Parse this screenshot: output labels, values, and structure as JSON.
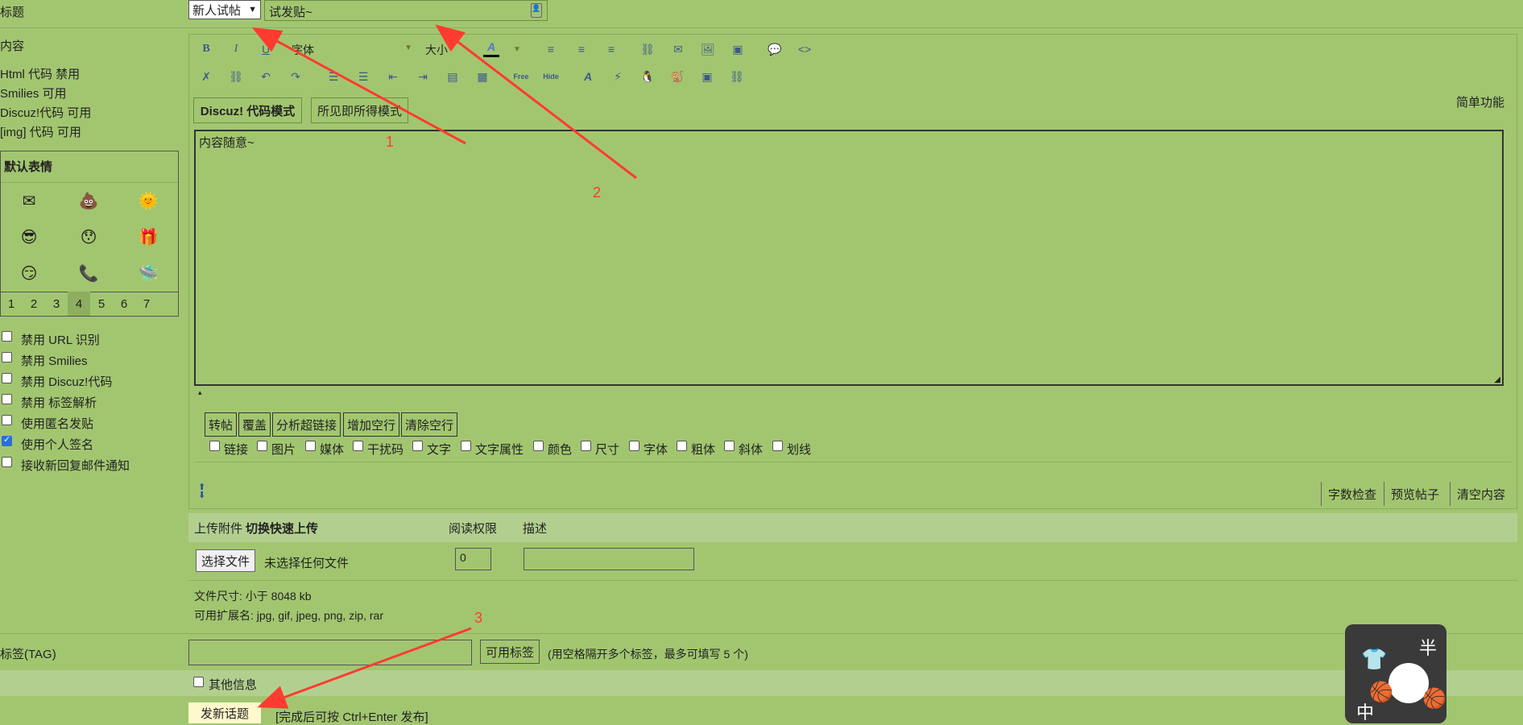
{
  "form": {
    "title_label": "标题",
    "title_type_selected": "新人试帖",
    "title_value": "试发贴~",
    "content_label": "内容",
    "content_status": [
      "Html 代码 禁用",
      "Smilies 可用",
      "Discuz!代码 可用",
      "[img] 代码 可用"
    ]
  },
  "toolbar": {
    "font_label": "字体",
    "size_label": "大小",
    "simple_mode": "简单功能",
    "modes": [
      "Discuz! 代码模式",
      "所见即所得模式"
    ]
  },
  "editor": {
    "content": "内容随意~",
    "format_buttons": [
      "转帖",
      "覆盖",
      "分析超链接",
      "增加空行",
      "清除空行"
    ],
    "filter_checkboxes": [
      "链接",
      "图片",
      "媒体",
      "干扰码",
      "文字",
      "文字属性",
      "颜色",
      "尺寸",
      "字体",
      "粗体",
      "斜体",
      "划线"
    ],
    "bottom_actions": [
      "字数检查",
      "预览帖子",
      "清空内容"
    ]
  },
  "smilies": {
    "header": "默认表情",
    "icons": [
      "mail",
      "poop",
      "sun",
      "cool",
      "shocked",
      "gift",
      "sly",
      "phone",
      "ufo"
    ],
    "pages": [
      "1",
      "2",
      "3",
      "4",
      "5",
      "6",
      "7"
    ],
    "active_page": "4"
  },
  "options": [
    {
      "label": "禁用 URL 识别",
      "checked": false
    },
    {
      "label": "禁用 Smilies",
      "checked": false
    },
    {
      "label": "禁用 Discuz!代码",
      "checked": false
    },
    {
      "label": "禁用 标签解析",
      "checked": false
    },
    {
      "label": "使用匿名发贴",
      "checked": false
    },
    {
      "label": "使用个人签名",
      "checked": true
    },
    {
      "label": "接收新回复邮件通知",
      "checked": false
    }
  ],
  "attachment": {
    "upload_label": "上传附件",
    "quick_upload": "切换快速上传",
    "read_perm_label": "阅读权限",
    "desc_label": "描述",
    "choose_file": "选择文件",
    "no_file": "未选择任何文件",
    "read_perm_value": "0",
    "size_text": "文件尺寸: 小于 8048 kb",
    "ext_text": "可用扩展名: jpg, gif, jpeg, png, zip, rar"
  },
  "tags": {
    "label": "标签(TAG)",
    "button": "可用标签",
    "hint": "(用空格隔开多个标签，最多可填写 5 个)"
  },
  "other_info": "其他信息",
  "submit": {
    "label": "发新话题",
    "hint": "[完成后可按 Ctrl+Enter 发布]"
  },
  "annotations": [
    "1",
    "2",
    "3"
  ],
  "mascot": {
    "top_text": "半",
    "bottom_text": "中"
  },
  "colors": {
    "page_bg": "#a2c670",
    "arrow": "#ff3b30",
    "submit_bg": "#fff8cc"
  }
}
